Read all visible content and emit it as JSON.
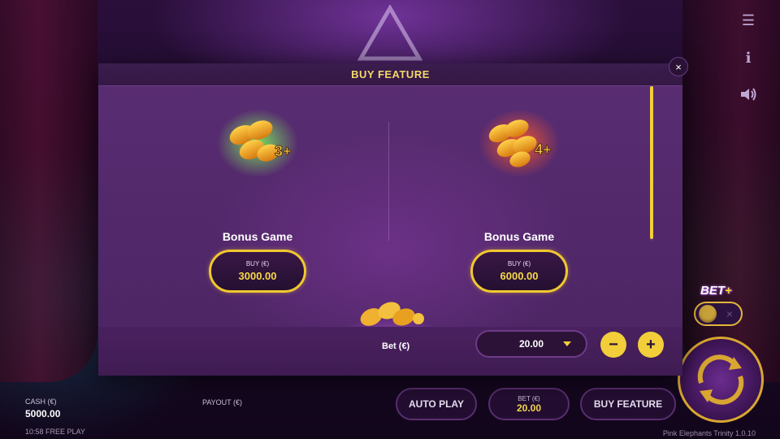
{
  "modal": {
    "title": "BUY FEATURE",
    "close_label": "×",
    "features": [
      {
        "title": "Bonus Game",
        "buy_label": "BUY (€)",
        "price": "3000.00",
        "badge": "3+"
      },
      {
        "title": "Bonus Game",
        "buy_label": "BUY (€)",
        "price": "6000.00",
        "badge": "4+"
      }
    ],
    "bet": {
      "label": "Bet (€)",
      "value": "20.00",
      "minus": "−",
      "plus": "+"
    }
  },
  "side": {
    "menu_icon": "☰",
    "info_icon": "i",
    "sound_icon": "speaker-icon"
  },
  "bet_plus": {
    "label": "BET",
    "plus": "+",
    "state_icon": "×"
  },
  "bottom": {
    "cash_label": "CASH (€)",
    "cash_value": "5000.00",
    "clock": "10:58 FREE PLAY",
    "payout_label": "PAYOUT (€)",
    "auto_play": "AUTO PLAY",
    "bet_label": "BET (€)",
    "bet_value": "20.00",
    "buy_feature": "BUY FEATURE",
    "version": "Pink Elephants Trinity   1.0.10"
  },
  "colors": {
    "accent_gold": "#f2cf3a",
    "modal_bg": "#4b2462",
    "glow_green": "#5fdc3a",
    "glow_red": "#ff4a2a",
    "glow_purple": "#b24ae0"
  }
}
